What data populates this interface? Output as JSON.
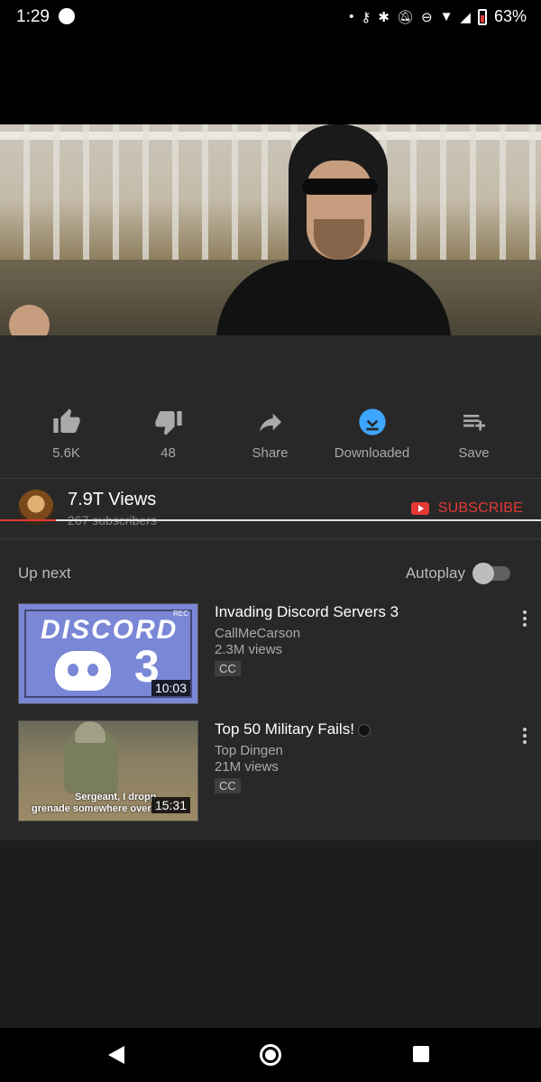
{
  "status_bar": {
    "time": "1:29",
    "battery": "63%"
  },
  "actions": [
    {
      "icon": "thumbs-up-icon",
      "label": "5.6K"
    },
    {
      "icon": "thumbs-down-icon",
      "label": "48"
    },
    {
      "icon": "share-icon",
      "label": "Share"
    },
    {
      "icon": "downloaded-icon",
      "label": "Downloaded"
    },
    {
      "icon": "save-icon",
      "label": "Save"
    }
  ],
  "channel": {
    "name": "7.9T Views",
    "subscribers": "267 subscribers",
    "subscribe_label": "SUBSCRIBE"
  },
  "up_next": {
    "heading": "Up next",
    "autoplay_label": "Autoplay",
    "autoplay_on": false
  },
  "recommendations": [
    {
      "title": "Invading Discord Servers 3",
      "channel": "CallMeCarson",
      "views": "2.3M views",
      "badge": "CC",
      "duration": "10:03",
      "thumb_word": "DISCORD",
      "thumb_number": "3",
      "thumb_rec": "REC"
    },
    {
      "title": "Top 50 Military Fails!",
      "channel": "Top Dingen",
      "views": "21M views",
      "badge": "CC",
      "duration": "15:31",
      "thumb_caption_1": "Sergeant, I dropp",
      "thumb_caption_2": "grenade somewhere over there."
    }
  ],
  "colors": {
    "accent_red": "#e53935",
    "download_blue": "#3ea6ff",
    "panel_bg": "#282828"
  }
}
